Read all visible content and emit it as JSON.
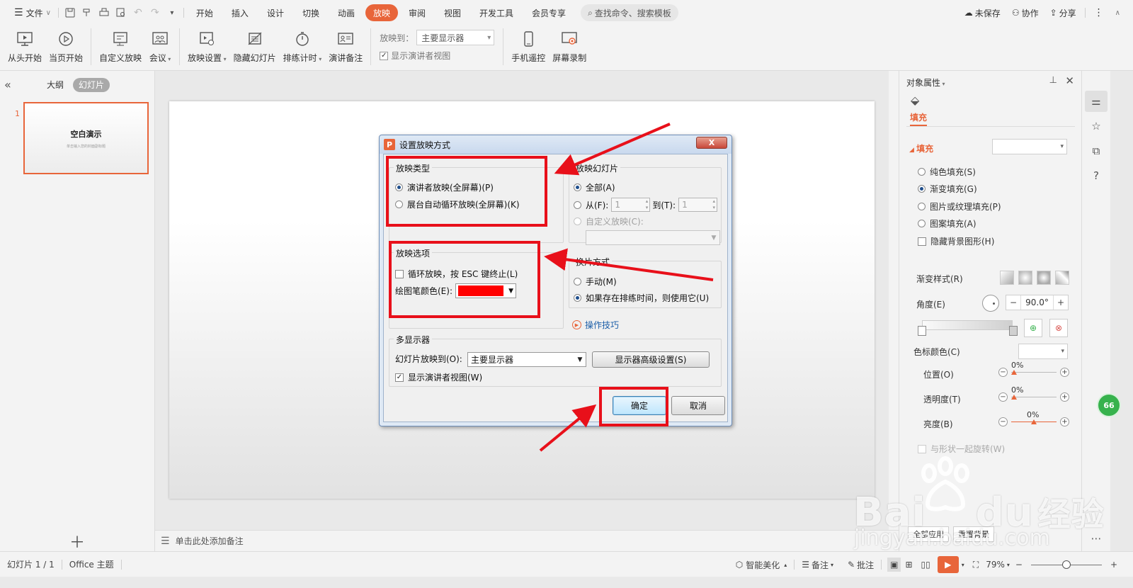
{
  "menubar": {
    "file_label": "文件",
    "tabs": [
      "开始",
      "插入",
      "设计",
      "切换",
      "动画",
      "放映",
      "审阅",
      "视图",
      "开发工具",
      "会员专享"
    ],
    "active_tab": "放映",
    "search_placeholder": "查找命令、搜索模板",
    "unsaved": "未保存",
    "collaborate": "协作",
    "share": "分享"
  },
  "ribbon": {
    "from_start": "从头开始",
    "from_current": "当页开始",
    "custom_show": "自定义放映",
    "meeting": "会议",
    "show_settings": "放映设置",
    "hide_slide": "隐藏幻灯片",
    "rehearse": "排练计时",
    "speaker_notes": "演讲备注",
    "play_to_label": "放映到：",
    "play_to_value": "主要显示器",
    "show_presenter_view": "显示演讲者视图",
    "phone_remote": "手机遥控",
    "screen_record": "屏幕录制"
  },
  "left_panel": {
    "tab_outline": "大纲",
    "tab_slides": "幻灯片",
    "slide_number": "1",
    "thumb_title": "空白演示",
    "thumb_subtitle": "单击输入您的封面副标题"
  },
  "notes_placeholder": "单击此处添加备注",
  "dialog": {
    "title": "设置放映方式",
    "close": "X",
    "show_type": {
      "title": "放映类型",
      "opt1": "演讲者放映(全屏幕)(P)",
      "opt2": "展台自动循环放映(全屏幕)(K)"
    },
    "show_slides": {
      "title": "放映幻灯片",
      "all": "全部(A)",
      "from": "从(F):",
      "from_value": "1",
      "to": "到(T):",
      "to_value": "1",
      "custom": "自定义放映(C):"
    },
    "show_options": {
      "title": "放映选项",
      "loop": "循环放映，按 ESC 键终止(L)",
      "pen_color": "绘图笔颜色(E):",
      "pen_color_value": "#ff0000"
    },
    "advance": {
      "title": "换片方式",
      "manual": "手动(M)",
      "timing": "如果存在排练时间，则使用它(U)"
    },
    "tips": "操作技巧",
    "multi_display": {
      "title": "多显示器",
      "play_to": "幻灯片放映到(O):",
      "play_to_value": "主要显示器",
      "advanced": "显示器高级设置(S)",
      "presenter_view": "显示演讲者视图(W)"
    },
    "ok": "确定",
    "cancel": "取消"
  },
  "right_panel": {
    "title": "对象属性",
    "fill_tab": "填充",
    "fill_section": "填充",
    "options": [
      "纯色填充(S)",
      "渐变填充(G)",
      "图片或纹理填充(P)",
      "图案填充(A)"
    ],
    "selected_option": "渐变填充(G)",
    "hide_bg": "隐藏背景图形(H)",
    "gradient_style": "渐变样式(R)",
    "angle": "角度(E)",
    "angle_value": "90.0°",
    "stop_color": "色标颜色(C)",
    "position": "位置(O)",
    "position_value": "0%",
    "transparency": "透明度(T)",
    "transparency_value": "0%",
    "brightness": "亮度(B)",
    "brightness_value": "0%",
    "rotate_with_shape": "与形状一起旋转(W)",
    "apply_all": "全部应用",
    "reset_bg": "重置背景"
  },
  "badge": "66",
  "statusbar": {
    "slide_info": "幻灯片 1 / 1",
    "theme": "Office 主题",
    "beautify": "智能美化",
    "notes": "备注",
    "comments": "批注",
    "zoom": "79%"
  },
  "watermark": {
    "brand": "Bai",
    "brand2": "du",
    "cn": "经验",
    "url": "jingyan.baidu.com"
  },
  "colors": {
    "accent": "#e8653a",
    "annotation_red": "#e8101a",
    "dialog_bg": "#f0f0f0"
  }
}
